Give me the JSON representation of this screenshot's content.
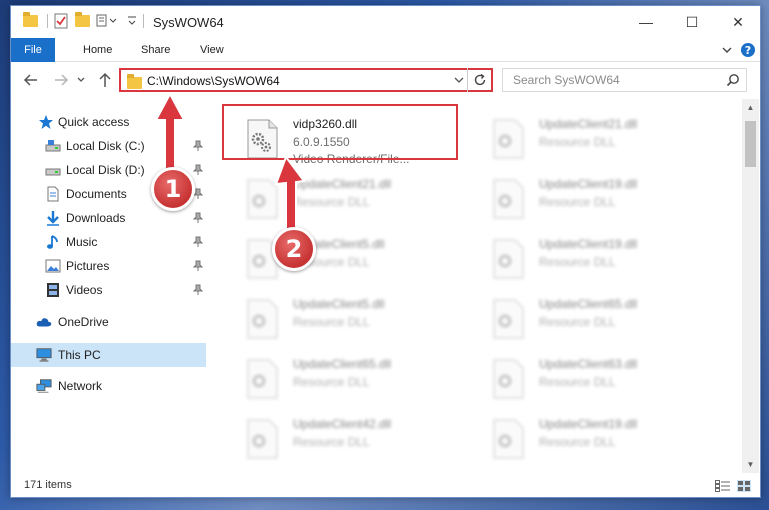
{
  "window": {
    "title": "SysWOW64",
    "controls": {
      "minimize": "—",
      "maximize": "☐",
      "close": "✕"
    }
  },
  "ribbon": {
    "tabs": [
      {
        "label": "File"
      },
      {
        "label": "Home"
      },
      {
        "label": "Share"
      },
      {
        "label": "View"
      }
    ],
    "expand_icon": "chevron-down-icon",
    "help_icon": "help-icon"
  },
  "navigation": {
    "address": "C:\\Windows\\SysWOW64",
    "search_placeholder": "Search SysWOW64"
  },
  "sidebar": {
    "items": [
      {
        "label": "Quick access",
        "icon": "star-icon",
        "pinned": false
      },
      {
        "label": "Local Disk (C:)",
        "icon": "drive-icon",
        "pinned": true
      },
      {
        "label": "Local Disk (D:)",
        "icon": "drive-icon",
        "pinned": true
      },
      {
        "label": "Documents",
        "icon": "document-icon",
        "pinned": true
      },
      {
        "label": "Downloads",
        "icon": "download-icon",
        "pinned": true
      },
      {
        "label": "Music",
        "icon": "music-icon",
        "pinned": true
      },
      {
        "label": "Pictures",
        "icon": "picture-icon",
        "pinned": true
      },
      {
        "label": "Videos",
        "icon": "video-icon",
        "pinned": true
      },
      {
        "label": "OneDrive",
        "icon": "cloud-icon",
        "pinned": false
      },
      {
        "label": "This PC",
        "icon": "computer-icon",
        "pinned": false
      },
      {
        "label": "Network",
        "icon": "network-icon",
        "pinned": false
      }
    ]
  },
  "files": [
    {
      "name": "vidp3260.dll",
      "version": "6.0.9.1550",
      "description": "Video Renderer/File...",
      "highlighted": true
    },
    {
      "name": "UpdateClient21.dll",
      "version": "",
      "description": "Resource DLL",
      "highlighted": false
    },
    {
      "name": "UpdateClient21.dll",
      "version": "",
      "description": "Resource DLL",
      "highlighted": false
    },
    {
      "name": "UpdateClient19.dll",
      "version": "",
      "description": "Resource DLL",
      "highlighted": false
    },
    {
      "name": "UpdateClient5.dll",
      "version": "",
      "description": "Resource DLL",
      "highlighted": false
    },
    {
      "name": "UpdateClient19.dll",
      "version": "",
      "description": "Resource DLL",
      "highlighted": false
    },
    {
      "name": "UpdateClient5.dll",
      "version": "",
      "description": "Resource DLL",
      "highlighted": false
    },
    {
      "name": "UpdateClient65.dll",
      "version": "",
      "description": "Resource DLL",
      "highlighted": false
    },
    {
      "name": "UpdateClient65.dll",
      "version": "",
      "description": "Resource DLL",
      "highlighted": false
    },
    {
      "name": "UpdateClient63.dll",
      "version": "",
      "description": "Resource DLL",
      "highlighted": false
    },
    {
      "name": "UpdateClient42.dll",
      "version": "",
      "description": "Resource DLL",
      "highlighted": false
    },
    {
      "name": "UpdateClient19.dll",
      "version": "",
      "description": "Resource DLL",
      "highlighted": false
    }
  ],
  "status": {
    "item_count": "171 items"
  },
  "annotations": [
    {
      "number": "1",
      "color": "#d9363e"
    },
    {
      "number": "2",
      "color": "#d9363e"
    }
  ]
}
